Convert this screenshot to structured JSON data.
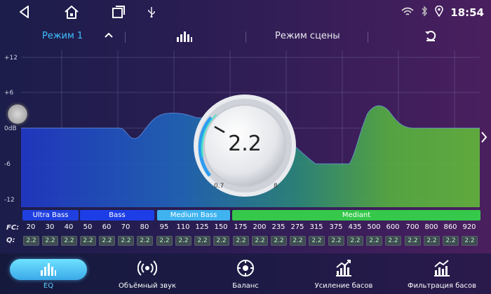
{
  "statusbar": {
    "time": "18:54",
    "icons": [
      "back-icon",
      "home-icon",
      "recent-apps-icon",
      "usb-icon",
      "wifi-icon",
      "bluetooth-icon",
      "location-icon"
    ]
  },
  "modebar": {
    "mode_label": "Режим 1",
    "scene_label": "Режим сцены"
  },
  "graph": {
    "y_labels": [
      "+12",
      "+6",
      "0dB",
      "-6",
      "-12"
    ]
  },
  "knob": {
    "value": "2.2",
    "min": "0.7",
    "max": "8"
  },
  "bands": [
    {
      "label": "Ultra Bass",
      "color": "#1f3fe0"
    },
    {
      "label": "Bass",
      "color": "#1d3ee6"
    },
    {
      "label": "Medium Bass",
      "color": "#3fb3f0"
    },
    {
      "label": "Mediant",
      "color": "#35c84a"
    }
  ],
  "fc": {
    "label": "FC:",
    "values": [
      "20",
      "30",
      "40",
      "50",
      "60",
      "70",
      "80",
      "95",
      "110",
      "125",
      "150",
      "175",
      "200",
      "235",
      "275",
      "315",
      "375",
      "435",
      "500",
      "600",
      "700",
      "800",
      "860",
      "920"
    ]
  },
  "q": {
    "label": "Q:",
    "values": [
      "2.2",
      "2.2",
      "2.2",
      "2.2",
      "2.2",
      "2.2",
      "2.2",
      "2.2",
      "2.2",
      "2.2",
      "2.2",
      "2.2",
      "2.2",
      "2.2",
      "2.2",
      "2.2",
      "2.2",
      "2.2",
      "2.2",
      "2.2",
      "2.2",
      "2.2",
      "2.2",
      "2.2"
    ]
  },
  "nav": [
    {
      "label": "EQ",
      "icon": "eq-icon",
      "active": true
    },
    {
      "label": "Объёмный звук",
      "icon": "surround-icon",
      "active": false
    },
    {
      "label": "Баланс",
      "icon": "balance-icon",
      "active": false
    },
    {
      "label": "Усиление басов",
      "icon": "bass-boost-icon",
      "active": false
    },
    {
      "label": "Фильтрация басов",
      "icon": "bass-filter-icon",
      "active": false
    }
  ]
}
